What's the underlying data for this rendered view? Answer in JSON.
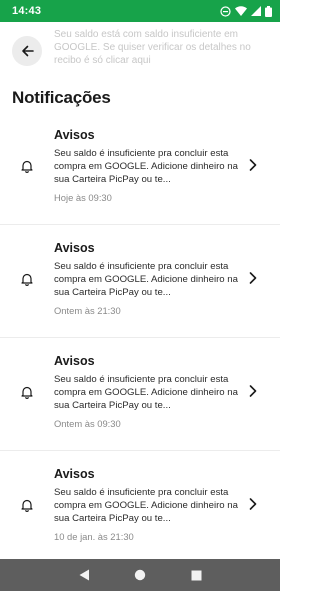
{
  "status_bar": {
    "time": "14:43",
    "icons": [
      "do-not-disturb-icon",
      "wifi-icon",
      "signal-icon",
      "battery-icon"
    ]
  },
  "background_text": "Seu saldo está com saldo insuficiente em GOOGLE. Se quiser verificar os detalhes no recibo é só clicar aqui",
  "header": {
    "back_icon": "arrow-left-icon",
    "title": "Notificações"
  },
  "notifications": [
    {
      "title": "Avisos",
      "body": "Seu saldo é insuficiente pra concluir esta compra em GOOGLE. Adicione dinheiro na sua Carteira PicPay ou te...",
      "time": "Hoje às 09:30"
    },
    {
      "title": "Avisos",
      "body": "Seu saldo é insuficiente pra concluir esta compra em GOOGLE. Adicione dinheiro na sua Carteira PicPay ou te...",
      "time": "Ontem às 21:30"
    },
    {
      "title": "Avisos",
      "body": "Seu saldo é insuficiente pra concluir esta compra em GOOGLE. Adicione dinheiro na sua Carteira PicPay ou te...",
      "time": "Ontem às 09:30"
    },
    {
      "title": "Avisos",
      "body": "Seu saldo é insuficiente pra concluir esta compra em GOOGLE. Adicione dinheiro na sua Carteira PicPay ou te...",
      "time": "10 de jan. às 21:30"
    }
  ],
  "nav_bar": {
    "buttons": [
      "back-triangle-icon",
      "home-circle-icon",
      "recents-square-icon"
    ]
  },
  "colors": {
    "status_bar": "#17a34a",
    "nav_bar": "#5e5e5e",
    "divider": "#ececec"
  }
}
